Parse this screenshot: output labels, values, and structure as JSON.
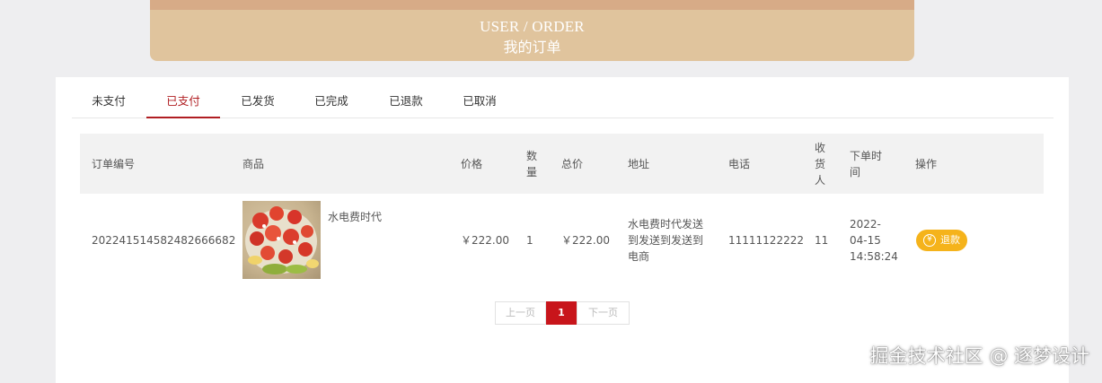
{
  "banner": {
    "title_en": "USER / ORDER",
    "title_cn": "我的订单"
  },
  "tabs": [
    {
      "label": "未支付"
    },
    {
      "label": "已支付",
      "active": true
    },
    {
      "label": "已发货"
    },
    {
      "label": "已完成"
    },
    {
      "label": "已退款"
    },
    {
      "label": "已取消"
    }
  ],
  "table": {
    "headers": {
      "order_no": "订单编号",
      "product": "商品",
      "price": "价格",
      "qty": "数量",
      "total": "总价",
      "address": "地址",
      "phone": "电话",
      "receiver": "收货人",
      "order_time": "下单时间",
      "action": "操作"
    },
    "rows": [
      {
        "order_no": "20224151458248266668​2",
        "product_name": "水电费时代",
        "price": "￥222.00",
        "qty": "1",
        "total": "￥222.00",
        "address": "水电费时代发送到发送到发送到电商",
        "phone": "11111122222",
        "receiver": "11",
        "order_time": "2022-04-15 14:58:24",
        "action_label": "退款"
      }
    ]
  },
  "pager": {
    "prev": "上一页",
    "current": "1",
    "next": "下一页"
  },
  "watermark": "掘金技术社区 @ 逐梦设计",
  "colors": {
    "accent": "#b01e22",
    "refund": "#f5b31b",
    "banner": "#e0c49d"
  }
}
